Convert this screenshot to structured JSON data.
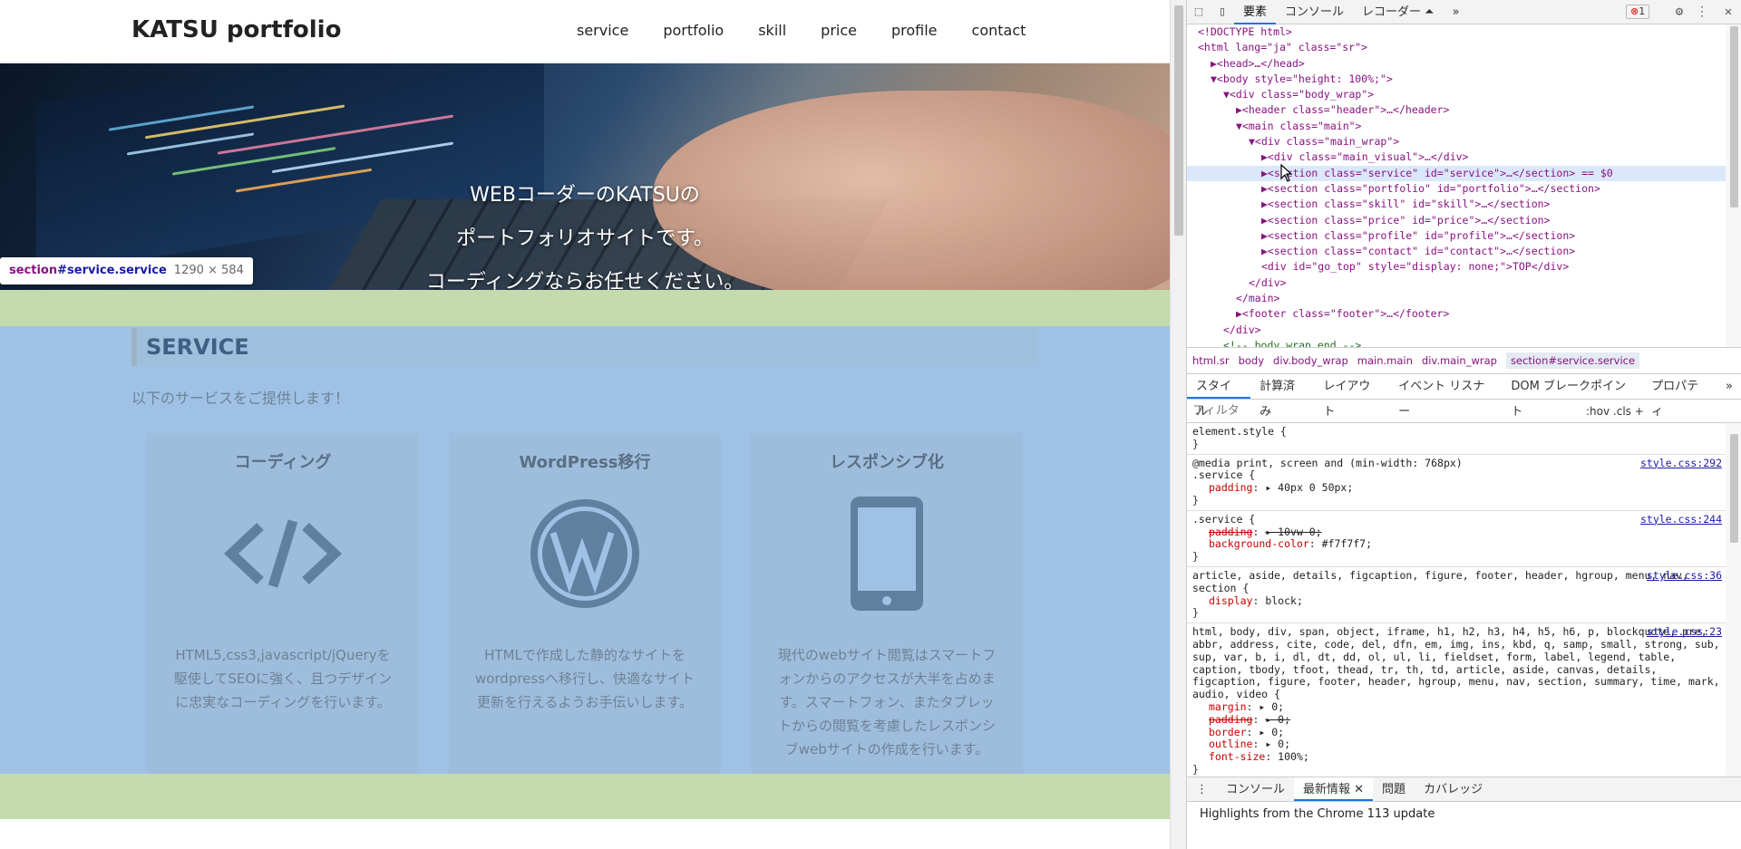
{
  "site": {
    "logo": "KATSU portfolio",
    "nav": [
      "service",
      "portfolio",
      "skill",
      "price",
      "profile",
      "contact"
    ],
    "hero_lines": [
      "WEBコーダーのKATSUの",
      "ポートフォリオサイトです。",
      "コーディングならお任せください。"
    ]
  },
  "inspect_tooltip": {
    "selector_tag": "section",
    "selector_rest": "#service.service",
    "size": "1290 × 584"
  },
  "service": {
    "title": "SERVICE",
    "description": "以下のサービスをご提供します！",
    "cards": [
      {
        "title": "コーディング",
        "icon": "code-icon",
        "text": "HTML5,css3,javascript/jQueryを駆使してSEOに強く、且つデザインに忠実なコーディングを行います。"
      },
      {
        "title": "WordPress移行",
        "icon": "wordpress-icon",
        "text": "HTMLで作成した静的なサイトをwordpressへ移行し、快適なサイト更新を行えるようお手伝いします。"
      },
      {
        "title": "レスポンシブ化",
        "icon": "smartphone-icon",
        "text": "現代のwebサイト閲覧はスマートフォンからのアクセスが大半を占めます。スマートフォン、またタブレットからの閲覧を考慮したレスポンシブwebサイトの作成を行います。"
      }
    ]
  },
  "devtools": {
    "tabs": [
      "要素",
      "コンソール",
      "レコーダー ⏶"
    ],
    "more": "»",
    "error_count": "1",
    "dom": [
      {
        "indent": 0,
        "text": "<!DOCTYPE html>"
      },
      {
        "indent": 0,
        "text": "<html lang=\"ja\" class=\"sr\">"
      },
      {
        "indent": 1,
        "text": "▶<head>…</head>"
      },
      {
        "indent": 1,
        "text": "▼<body style=\"height: 100%;\">"
      },
      {
        "indent": 2,
        "text": "▼<div class=\"body_wrap\">"
      },
      {
        "indent": 3,
        "text": "▶<header class=\"header\">…</header>"
      },
      {
        "indent": 3,
        "text": "▼<main class=\"main\">"
      },
      {
        "indent": 4,
        "text": "▼<div class=\"main_wrap\">"
      },
      {
        "indent": 5,
        "text": "▶<div class=\"main_visual\">…</div>"
      },
      {
        "indent": 5,
        "text": "▶<section class=\"service\" id=\"service\">…</section> == $0",
        "selected": true
      },
      {
        "indent": 5,
        "text": "▶<section class=\"portfolio\" id=\"portfolio\">…</section>"
      },
      {
        "indent": 5,
        "text": "▶<section class=\"skill\" id=\"skill\">…</section>"
      },
      {
        "indent": 5,
        "text": "▶<section class=\"price\" id=\"price\">…</section>"
      },
      {
        "indent": 5,
        "text": "▶<section class=\"profile\" id=\"profile\">…</section>"
      },
      {
        "indent": 5,
        "text": "▶<section class=\"contact\" id=\"contact\">…</section>"
      },
      {
        "indent": 5,
        "text": "<div id=\"go_top\" style=\"display: none;\">TOP</div>"
      },
      {
        "indent": 4,
        "text": "</div>"
      },
      {
        "indent": 3,
        "text": "</main>"
      },
      {
        "indent": 3,
        "text": "▶<footer class=\"footer\">…</footer>"
      },
      {
        "indent": 2,
        "text": "</div>"
      },
      {
        "indent": 2,
        "text": "<!-- body_wrap end -->"
      }
    ],
    "breadcrumbs": [
      "html.sr",
      "body",
      "div.body_wrap",
      "main.main",
      "div.main_wrap",
      "section#service.service"
    ],
    "style_tabs": [
      "スタイル",
      "計算済み",
      "レイアウト",
      "イベント リスナー",
      "DOM ブレークポイント",
      "プロパティ",
      "»"
    ],
    "filter_placeholder": "フィルタ",
    "filter_tools": ":hov  .cls  +",
    "rules": [
      {
        "selector": "element.style {",
        "source": "",
        "props": []
      },
      {
        "selector": "@media print, screen and (min-width: 768px)\n.service {",
        "source": "style.css:292",
        "props": [
          {
            "n": "padding",
            "v": "▸ 40px 0 50px;"
          }
        ]
      },
      {
        "selector": ".service {",
        "source": "style.css:244",
        "props": [
          {
            "n": "padding",
            "v": "▸ 10vw 0;",
            "strike": true
          },
          {
            "n": "background-color",
            "v": "#f7f7f7;"
          }
        ]
      },
      {
        "selector": "article, aside, details, figcaption, figure, footer, header, hgroup, menu, nav, section {",
        "source": "style.css:36",
        "props": [
          {
            "n": "display",
            "v": "block;"
          }
        ]
      },
      {
        "selector": "html, body, div, span, object, iframe, h1, h2, h3, h4, h5, h6, p, blockquote, pre, abbr, address, cite, code, del, dfn, em, img, ins, kbd, q, samp, small, strong, sub, sup, var, b, i, dl, dt, dd, ol, ul, li, fieldset, form, label, legend, table, caption, tbody, tfoot, thead, tr, th, td, article, aside, canvas, details, figcaption, figure, footer, header, hgroup, menu, nav, section, summary, time, mark, audio, video {",
        "source": "style.css:23",
        "props": [
          {
            "n": "margin",
            "v": "▸ 0;"
          },
          {
            "n": "padding",
            "v": "▸ 0;",
            "strike": true
          },
          {
            "n": "border",
            "v": "▸ 0;"
          },
          {
            "n": "outline",
            "v": "▸ 0;"
          },
          {
            "n": "font-size",
            "v": "100%;"
          }
        ]
      }
    ],
    "drawer_tabs": [
      "コンソール",
      "最新情報",
      "問題",
      "カバレッジ"
    ],
    "drawer_message": "Highlights from the Chrome 113 update"
  }
}
